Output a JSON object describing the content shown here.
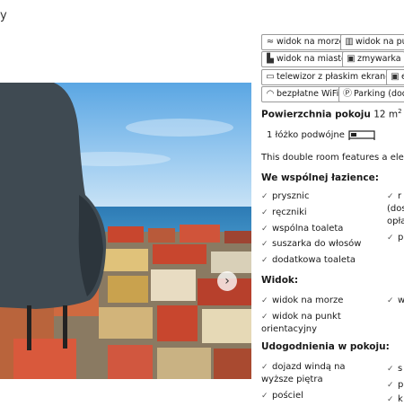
{
  "header": {
    "fragment": "y"
  },
  "gallery": {
    "next_label": "›"
  },
  "facility_chips": [
    {
      "icon": "water-view-icon",
      "glyph": "≈",
      "label": "widok na morze"
    },
    {
      "icon": "landmark-icon",
      "glyph": "▥",
      "label": "widok na pun"
    },
    {
      "icon": "city-icon",
      "glyph": "▙",
      "label": "widok na miasto"
    },
    {
      "icon": "dishwasher-icon",
      "glyph": "▣",
      "label": "zmywarka"
    },
    {
      "icon": "tv-icon",
      "glyph": "▭",
      "label": "telewizor z płaskim ekranem"
    },
    {
      "icon": "more-icon",
      "glyph": "▣",
      "label": "e"
    },
    {
      "icon": "wifi-icon",
      "glyph": "◠",
      "label": "bezpłatne WiFi"
    },
    {
      "icon": "parking-icon",
      "glyph": "Ⓟ",
      "label": "Parking (doda"
    }
  ],
  "room": {
    "size_label": "Powierzchnia pokoju",
    "size_value": "12 m",
    "size_unit_sup": "2",
    "bed_text": "1 łóżko podwójne",
    "description": "This double room features a electric"
  },
  "sections": {
    "bathroom": {
      "title": "We wspólnej łazience:",
      "left": [
        "prysznic",
        "ręczniki",
        "wspólna toaleta",
        "suszarka do włosów",
        "dodatkowa toaleta"
      ],
      "right_fragments": [
        "r",
        "(dos",
        "opła",
        "p"
      ]
    },
    "view": {
      "title": "Widok:",
      "left": [
        "widok na morze",
        "widok na punkt orientacyjny"
      ],
      "right_fragments": [
        "w"
      ]
    },
    "amenities": {
      "title": "Udogodnienia w pokoju:",
      "left": [
        "dojazd windą na wyższe piętra",
        "pościel"
      ],
      "right_fragments": [
        "s",
        "p",
        "k"
      ]
    }
  },
  "colors": {
    "chip_border": "#9a9a9a",
    "sky": "#6fb2e6",
    "sea": "#2f7fb8",
    "roofs": "#c8462e",
    "bird": "#3f4a52"
  }
}
